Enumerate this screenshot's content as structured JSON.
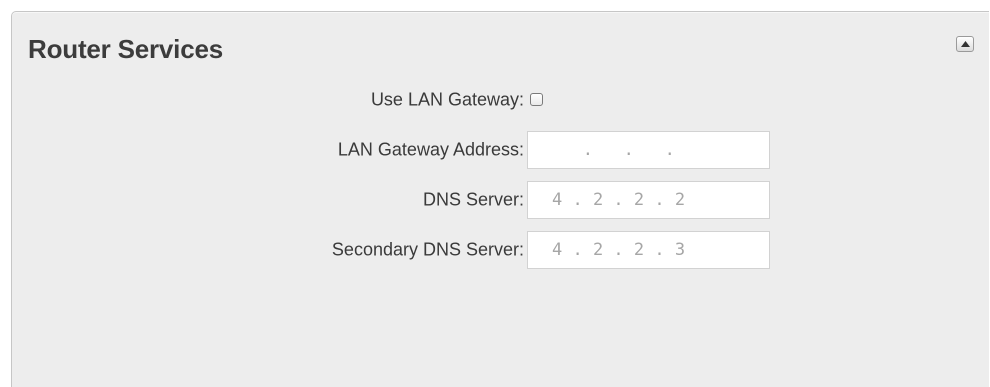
{
  "panel": {
    "title": "Router Services",
    "collapse_icon": "triangle-up-icon"
  },
  "form": {
    "use_lan_gateway": {
      "label": "Use LAN Gateway:",
      "checked": false
    },
    "lan_gateway_address": {
      "label": "LAN Gateway Address:",
      "value": "   .   .   ."
    },
    "dns_server": {
      "label": "DNS Server:",
      "value": "4 . 2 . 2 . 2"
    },
    "secondary_dns_server": {
      "label": "Secondary DNS Server:",
      "value": "4 . 2 . 2 . 3"
    }
  }
}
